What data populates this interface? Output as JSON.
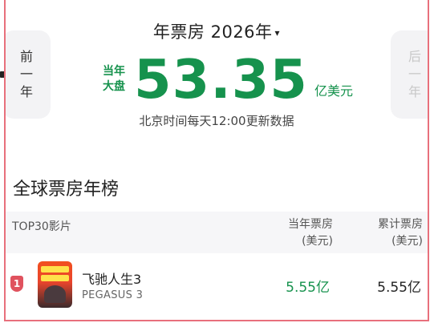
{
  "nav": {
    "prev_label": [
      "前",
      "一",
      "年"
    ],
    "next_label": [
      "后",
      "一",
      "年"
    ]
  },
  "header": {
    "title": "年票房 2026年",
    "caret": "▾"
  },
  "board": {
    "label_line1": "当年",
    "label_line2": "大盘",
    "value": "53.35",
    "unit": "亿美元"
  },
  "update_note": "北京时间每天12:00更新数据",
  "section": {
    "title": "全球票房年榜"
  },
  "table": {
    "col_name": "TOP30影片",
    "col_year_line1": "当年票房",
    "col_year_line2": "(美元)",
    "col_total_line1": "累计票房",
    "col_total_line2": "(美元)",
    "rows": [
      {
        "rank": "1",
        "name": "飞驰人生3",
        "en_name": "PEGASUS 3",
        "year_box": "5.55亿",
        "total_box": "5.55亿"
      }
    ]
  },
  "colors": {
    "accent_green": "#16924d",
    "frame_red": "#e8707c",
    "rank_red": "#e0525e"
  }
}
